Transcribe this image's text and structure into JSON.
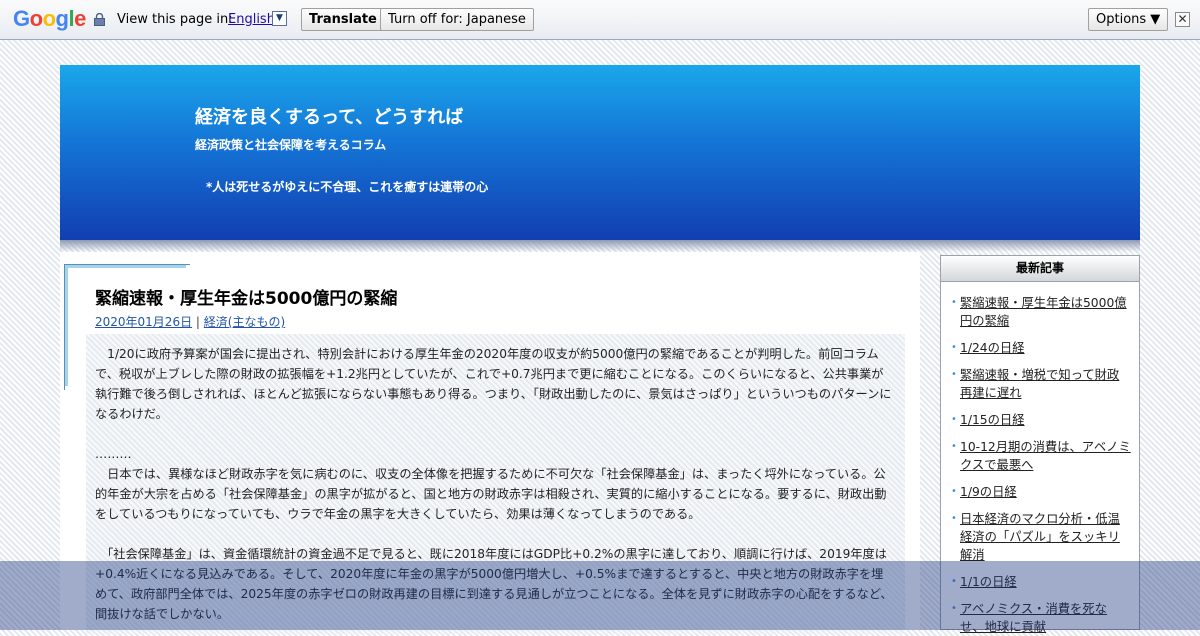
{
  "translate_bar": {
    "google_logo": "Google",
    "view_label": "View this page in:",
    "language": "English",
    "translate_button": "Translate",
    "turn_off_button": "Turn off for: Japanese",
    "options_button": "Options ▼",
    "close_glyph": "✕",
    "dropdown_glyph": "▼"
  },
  "header": {
    "title": "経済を良くするって、どうすれば",
    "description": "経済政策と社会保障を考えるコラム",
    "motto": "*人は死せるがゆえに不合理、これを癒すは連帯の心"
  },
  "post": {
    "title": "緊縮速報・厚生年金は5000億円の緊縮",
    "date": "2020年01月26日",
    "separator": "|",
    "category": "経済(主なもの)",
    "paragraphs": [
      "　1/20に政府予算案が国会に提出され、特別会計における厚生年金の2020年度の収支が約5000億円の緊縮であることが判明した。前回コラムで、税収が上ブレした際の財政の拡張幅を+1.2兆円としていたが、これで+0.7兆円まで更に縮むことになる。このくらいになると、公共事業が執行難で後ろ倒しされれば、ほとんど拡張にならない事態もあり得る。つまり、「財政出動したのに、景気はさっぱり」といういつものパターンになるわけだ。",
      "………",
      "　日本では、異様なほど財政赤字を気に病むのに、収支の全体像を把握するために不可欠な「社会保障基金」は、まったく埒外になっている。公的年金が大宗を占める「社会保障基金」の黒字が拡がると、国と地方の財政赤字は相殺され、実質的に縮小することになる。要するに、財政出動をしているつもりになっていても、ウラで年金の黒字を大きくしていたら、効果は薄くなってしまうのである。",
      "　「社会保障基金」は、資金循環統計の資金過不足で見ると、既に2018年度にはGDP比+0.2%の黒字に達しており、順調に行けば、2019年度は+0.4%近くになる見込みである。そして、2020年度に年金の黒字が5000億円増大し、+0.5%まで達するとすると、中央と地方の財政赤字を埋めて、政府部門全体では、2025年度の赤字ゼロの財政再建の目標に到達する見通しが立つことになる。全体を見ずに財政赤字の心配をするなど、間抜けな話でしかない。"
    ]
  },
  "sidebar": {
    "heading": "最新記事",
    "items": [
      "緊縮速報・厚生年金は5000億円の緊縮",
      "1/24の日経",
      "緊縮速報・増税で知って財政再建に遅れ",
      "1/15の日経",
      "10-12月期の消費は、アベノミクスで最悪へ",
      "1/9の日経",
      "日本経済のマクロ分析・低温経済の「パズル」をスッキリ解消",
      "1/1の日経",
      "アベノミクス・消費を死なせ、地球に貢献"
    ]
  },
  "colors": {
    "header_top": "#1aa7ea",
    "header_bottom": "#123eb0",
    "link": "#2255aa",
    "bullet": "#4a90e2"
  }
}
